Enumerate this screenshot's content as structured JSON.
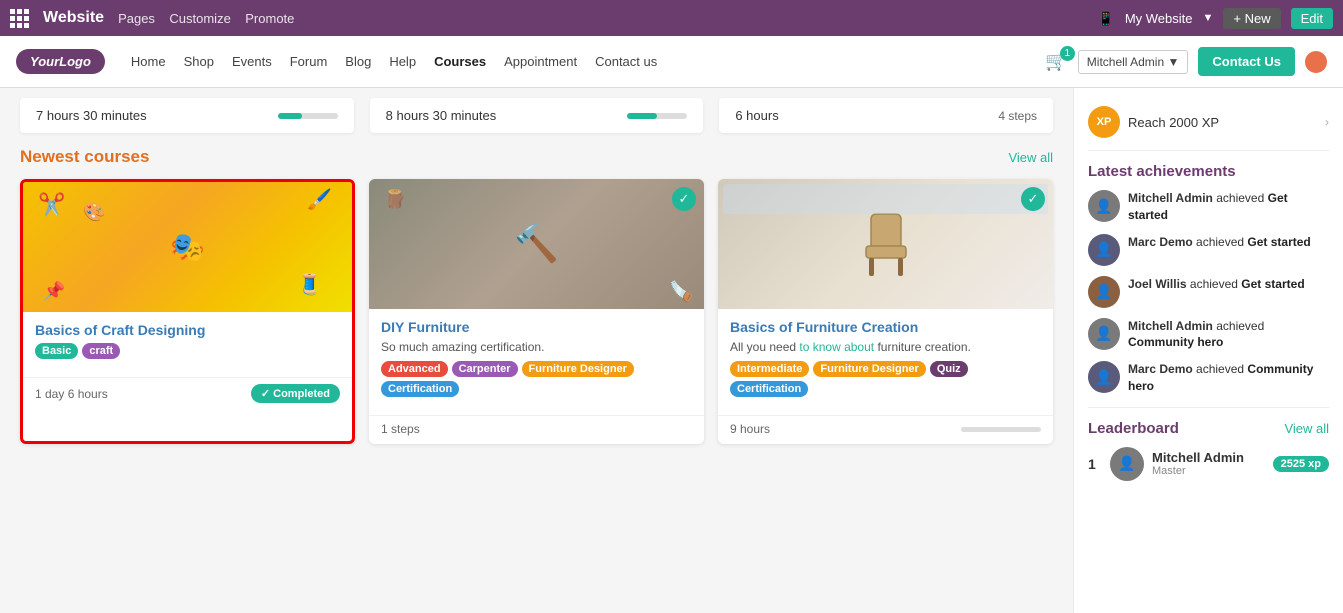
{
  "admin_bar": {
    "brand": "Website",
    "nav_items": [
      "Pages",
      "Customize",
      "Promote"
    ],
    "my_website": "My Website",
    "btn_new": "+ New",
    "btn_edit": "Edit"
  },
  "site_nav": {
    "logo": "YourLogo",
    "links": [
      "Home",
      "Shop",
      "Events",
      "Forum",
      "Blog",
      "Help",
      "Courses",
      "Appointment",
      "Contact us"
    ],
    "active_link": "Courses",
    "cart_count": "1",
    "user": "Mitchell Admin",
    "contact_us_btn": "Contact Us"
  },
  "duration_row": [
    {
      "time": "7 hours 30 minutes",
      "progress": 40
    },
    {
      "time": "8 hours 30 minutes",
      "progress": 50
    },
    {
      "time": "6 hours",
      "steps": "4 steps"
    }
  ],
  "newest_courses": {
    "title": "Newest courses",
    "view_all": "View all",
    "courses": [
      {
        "id": "craft",
        "title": "Basics of Craft Designing",
        "tags": [
          {
            "label": "Basic",
            "class": "tag-basic"
          },
          {
            "label": "craft",
            "class": "tag-craft"
          }
        ],
        "duration": "1 day 6 hours",
        "completed": true,
        "completed_label": "✓ Completed",
        "selected": true
      },
      {
        "id": "diy",
        "title": "DIY Furniture",
        "desc": "So much amazing certification.",
        "tags": [
          {
            "label": "Advanced",
            "class": "tag-advanced"
          },
          {
            "label": "Carpenter",
            "class": "tag-carpenter"
          },
          {
            "label": "Furniture Designer",
            "class": "tag-furniture"
          },
          {
            "label": "Certification",
            "class": "tag-certification"
          }
        ],
        "duration": "1 steps",
        "has_check": true
      },
      {
        "id": "furniture",
        "title": "Basics of Furniture Creation",
        "desc_plain": "All you need ",
        "desc_highlight": "to know about",
        "desc_end": " furniture creation.",
        "tags": [
          {
            "label": "Intermediate",
            "class": "tag-intermediate"
          },
          {
            "label": "Furniture Designer",
            "class": "tag-furniture"
          },
          {
            "label": "Quiz",
            "class": "tag-quiz"
          },
          {
            "label": "Certification",
            "class": "tag-certification"
          }
        ],
        "duration": "9 hours",
        "has_check": true
      }
    ]
  },
  "right_sidebar": {
    "reach_xp": "Reach 2000 XP",
    "achievements_title": "Latest achievements",
    "achievements": [
      {
        "user": "Mitchell Admin",
        "action": "achieved",
        "label": "Get started",
        "avatar_class": "avatar-mitchell",
        "icon": "👤"
      },
      {
        "user": "Marc Demo",
        "action": "achieved",
        "label": "Get started",
        "avatar_class": "avatar-marc",
        "icon": "👤"
      },
      {
        "user": "Joel Willis",
        "action": "achieved",
        "label": "Get started",
        "avatar_class": "avatar-joel",
        "icon": "👤"
      },
      {
        "user": "Mitchell Admin",
        "action": "achieved",
        "label": "Community hero",
        "avatar_class": "avatar-mitchell",
        "icon": "👤"
      },
      {
        "user": "Marc Demo",
        "action": "achieved",
        "label": "Community hero",
        "avatar_class": "avatar-marc",
        "icon": "👤"
      }
    ],
    "leaderboard_title": "Leaderboard",
    "leaderboard_view_all": "View all",
    "leaderboard": [
      {
        "rank": "1",
        "name": "Mitchell Admin",
        "level": "Master",
        "xp": "2525 xp",
        "avatar_class": "avatar-mitchell",
        "icon": "👤"
      }
    ]
  }
}
